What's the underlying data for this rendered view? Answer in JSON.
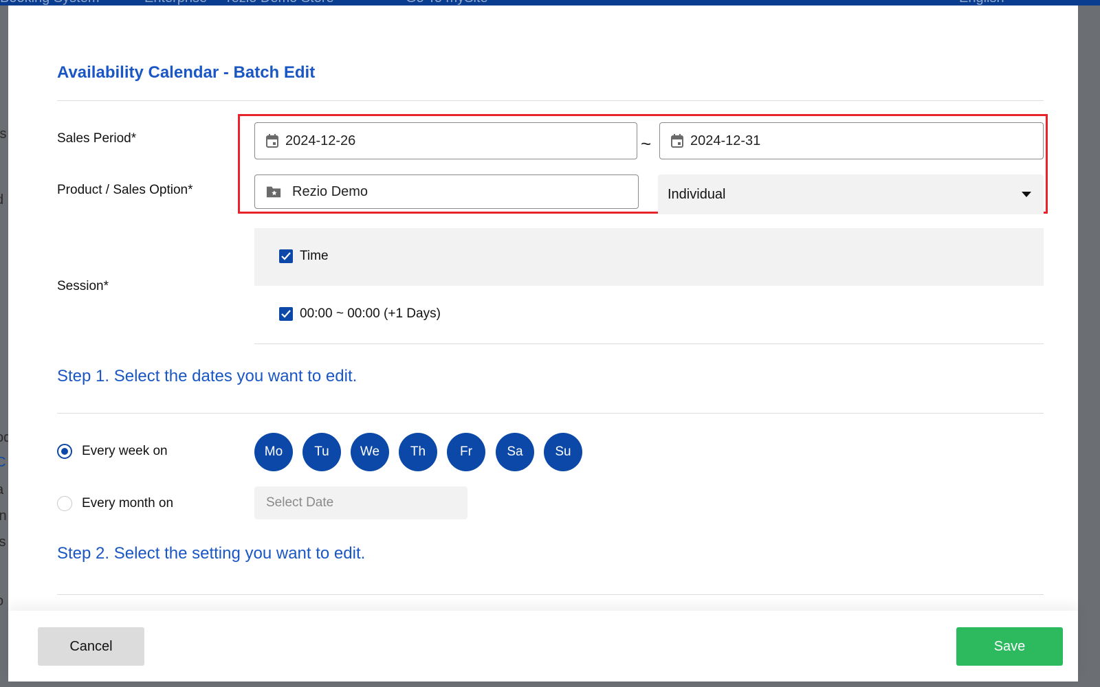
{
  "backdrop": {
    "topbar_texts": [
      "Booking System",
      "Enterprise",
      "rezio Demo Store",
      "Go To mySite",
      "English"
    ],
    "left_fragments": [
      "ts",
      "d",
      "od",
      "C",
      "a",
      "in",
      "is",
      "o"
    ]
  },
  "modal": {
    "title": "Availability Calendar - Batch Edit",
    "sales_period": {
      "label": "Sales Period*",
      "start_date": "2024-12-26",
      "separator": "~",
      "end_date": "2024-12-31",
      "icon": "calendar-icon"
    },
    "product": {
      "label": "Product / Sales Option*",
      "product_value": "Rezio Demo",
      "product_icon": "folder-star-icon",
      "option_value": "Individual"
    },
    "session": {
      "label": "Session*",
      "type_option": "Time",
      "time_slot": "00:00 ~ 00:00 (+1 Days)"
    },
    "step1": {
      "title": "Step 1. Select the dates you want to edit.",
      "weekly_label": "Every week on",
      "monthly_label": "Every month on",
      "monthly_placeholder": "Select Date",
      "selected_mode": "weekly",
      "days": [
        "Mo",
        "Tu",
        "We",
        "Th",
        "Fr",
        "Sa",
        "Su"
      ]
    },
    "step2": {
      "title": "Step 2. Select the setting you want to edit."
    },
    "footer": {
      "cancel_label": "Cancel",
      "save_label": "Save"
    }
  },
  "colors": {
    "accent": "#0b48a8",
    "title": "#1a56c4",
    "highlight": "#e8232a",
    "save": "#2dba5e"
  }
}
